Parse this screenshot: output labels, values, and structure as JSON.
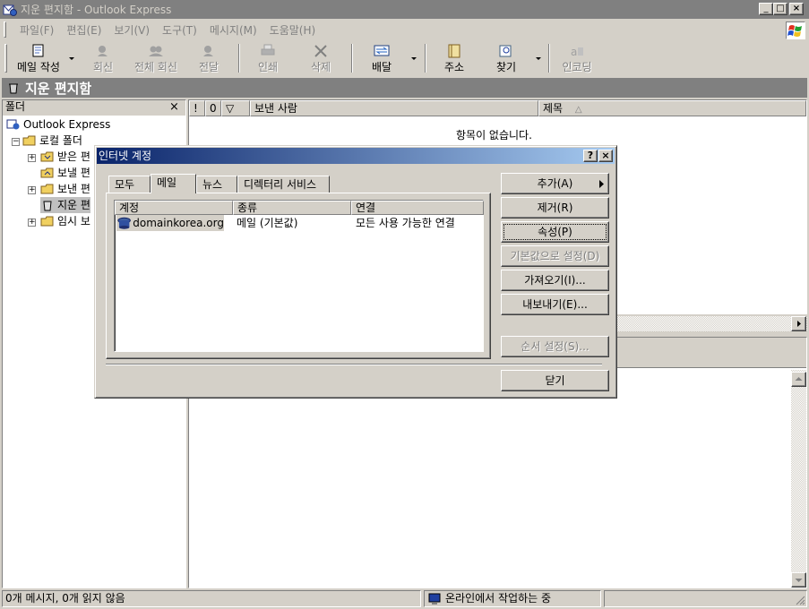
{
  "window": {
    "title": "지운 편지함 - Outlook Express"
  },
  "menu": [
    "파일(F)",
    "편집(E)",
    "보기(V)",
    "도구(T)",
    "메시지(M)",
    "도움말(H)"
  ],
  "toolbar": {
    "create_mail": "메일 작성",
    "reply": "회신",
    "reply_all": "전체 회신",
    "forward": "전달",
    "print": "인쇄",
    "delete": "삭제",
    "send_receive": "배달",
    "addresses": "주소",
    "find": "찾기",
    "encoding": "인코딩"
  },
  "folder_header": "지운 편지함",
  "folders": {
    "header": "폴더",
    "root": "Outlook Express",
    "local": "로컬 폴더",
    "inbox": "받은 편",
    "outbox": "보낼 편",
    "sent": "보낸 편",
    "deleted": "지운 편",
    "drafts": "임시 보"
  },
  "message_list": {
    "columns": [
      "!",
      "0",
      "▽",
      "보낸 사람",
      "제목"
    ],
    "sort_indicator": "△",
    "empty_message": "항목이 없습니다."
  },
  "status": {
    "counts": "0개 메시지, 0개 읽지 않음",
    "online": "온라인에서 작업하는 중"
  },
  "dialog": {
    "title": "인터넷 계정",
    "help_button": "?",
    "close_button": "×",
    "tabs": [
      "모두",
      "메일",
      "뉴스",
      "디렉터리 서비스"
    ],
    "active_tab": "메일",
    "columns": [
      "계정",
      "종류",
      "연결"
    ],
    "accounts": [
      {
        "name": "domainkorea.org",
        "type": "메일 (기본값)",
        "connection": "모든 사용 가능한 연결"
      }
    ],
    "buttons": {
      "add": "추가(A)",
      "remove": "제거(R)",
      "properties": "속성(P)",
      "set_default": "기본값으로 설정(D)",
      "import": "가져오기(I)...",
      "export": "내보내기(E)...",
      "set_order": "순서 설정(S)...",
      "close": "닫기"
    }
  }
}
